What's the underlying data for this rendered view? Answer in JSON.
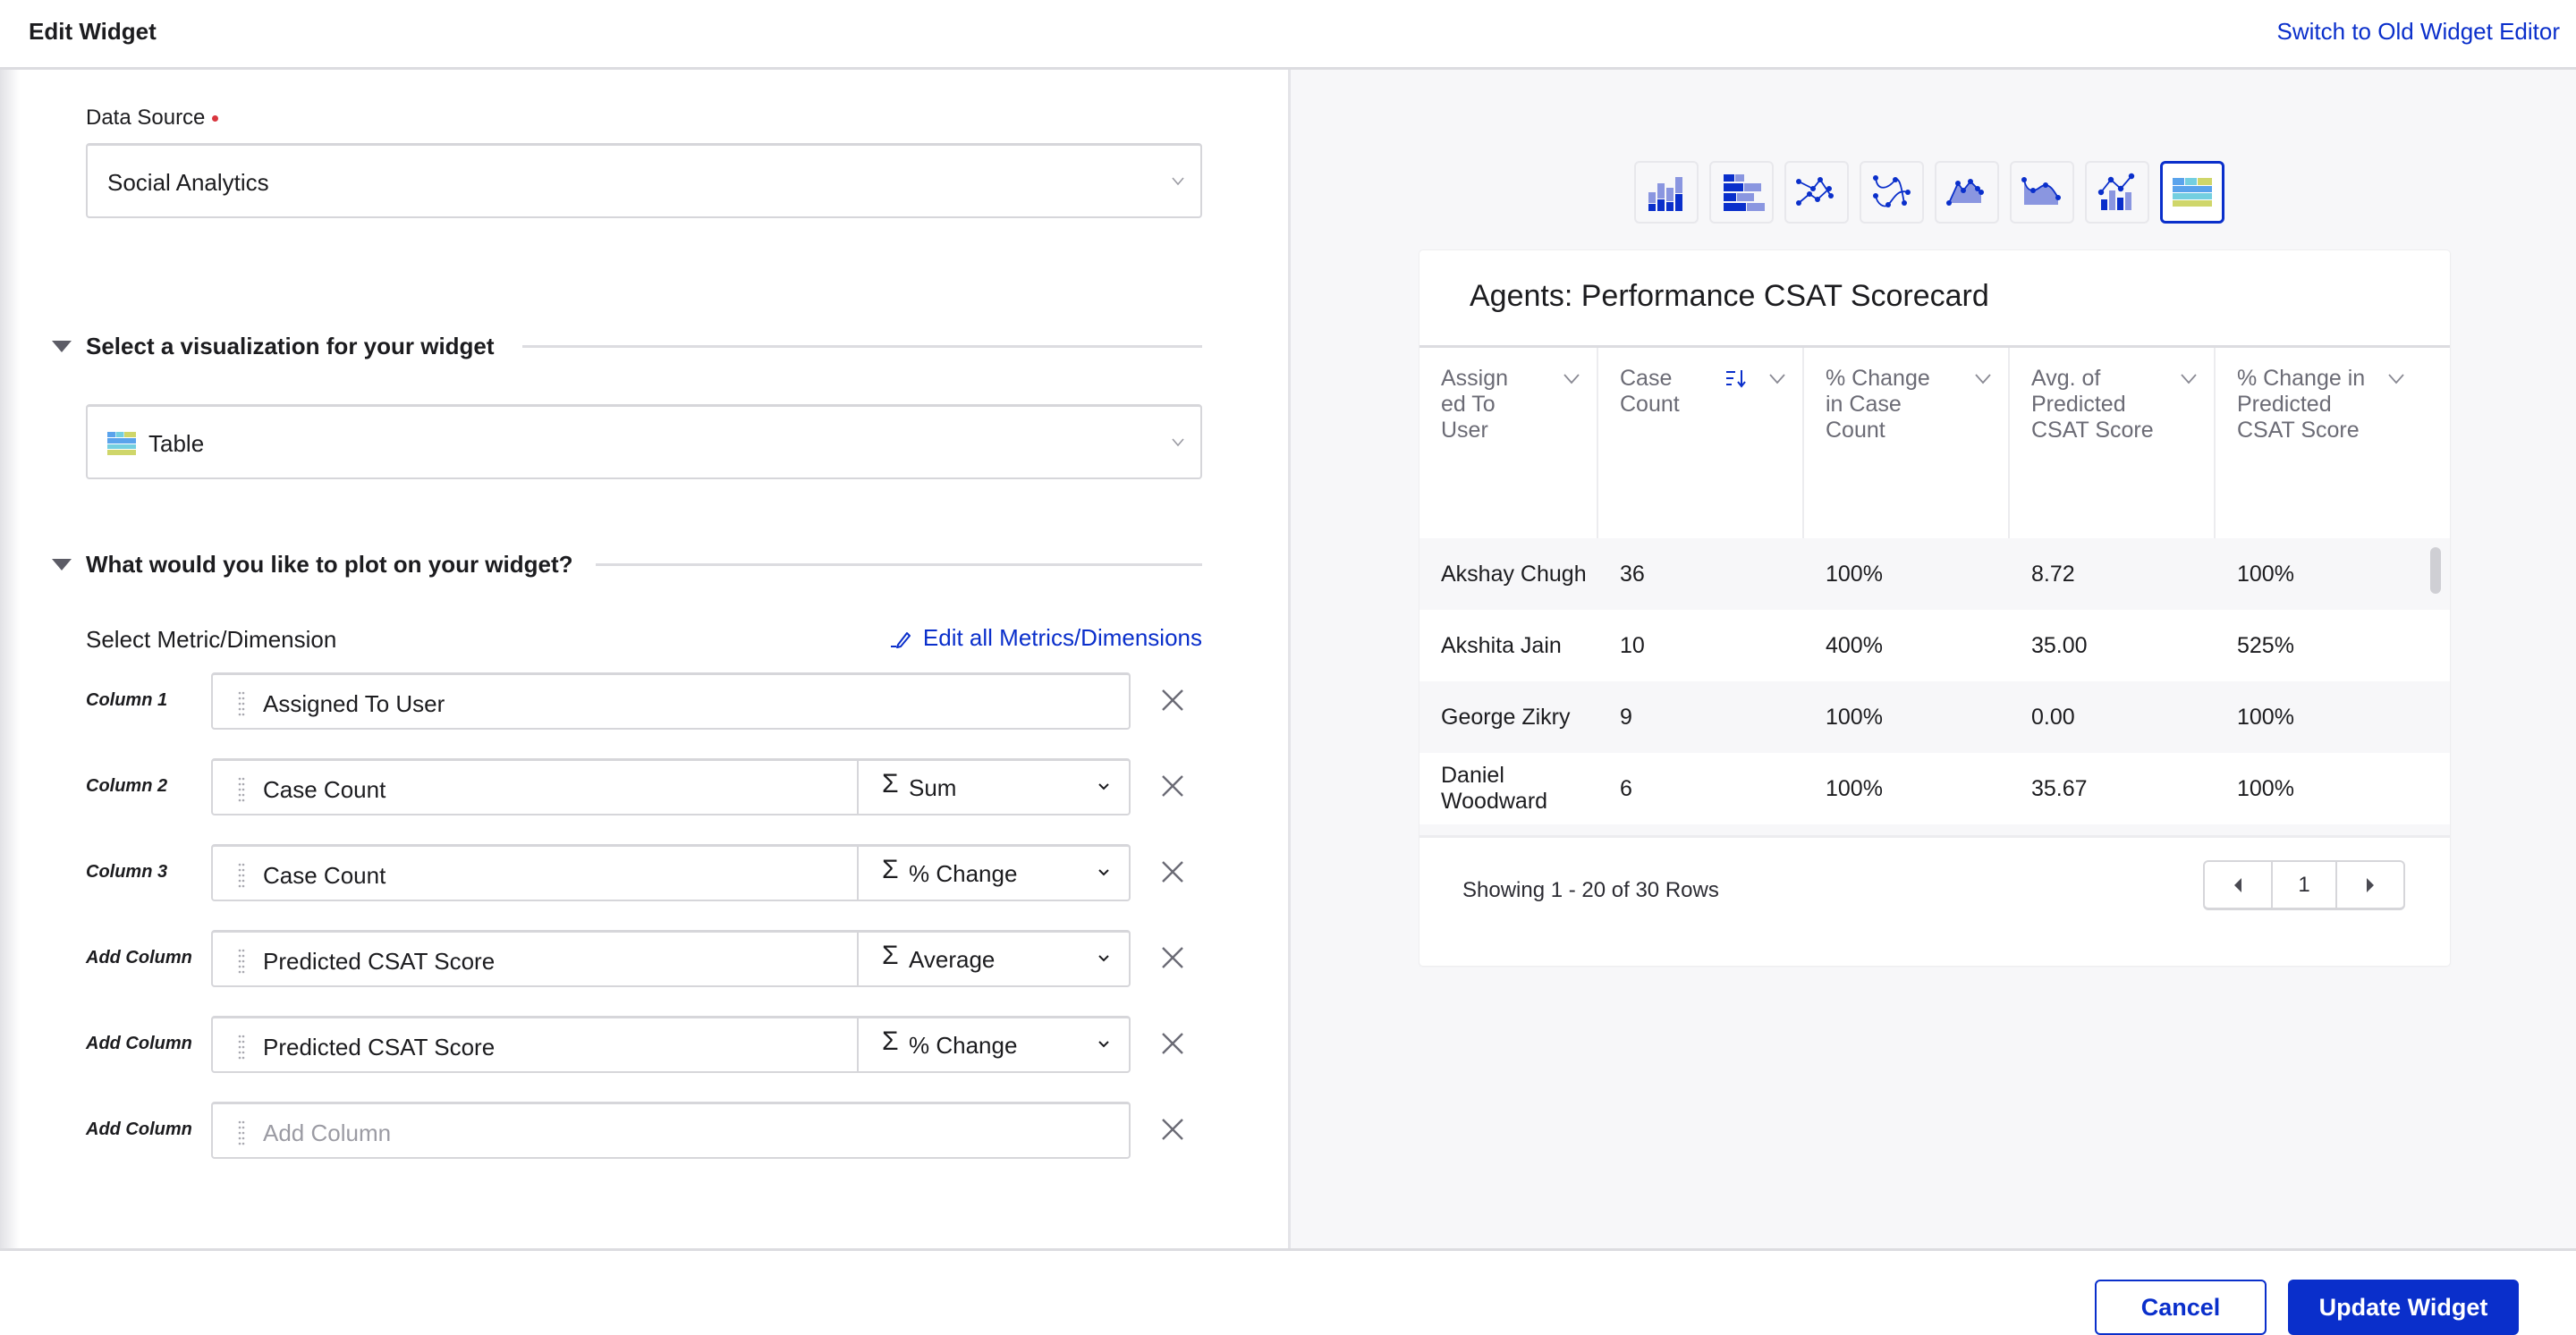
{
  "header": {
    "title": "Edit Widget",
    "switch_link": "Switch to Old Widget Editor"
  },
  "form": {
    "data_source": {
      "label": "Data Source",
      "required": true,
      "value": "Social Analytics",
      "icon": "chevron-down-icon"
    },
    "visualization_section": {
      "heading": "Select a visualization for your widget",
      "value": "Table",
      "icon": "table-viz-icon"
    },
    "plot_section": {
      "heading": "What would you like to plot on your widget?",
      "metric_label": "Select Metric/Dimension",
      "edit_all_link": "Edit all Metrics/Dimensions",
      "columns": [
        {
          "label": "Column 1",
          "field": "Assigned To User",
          "aggregation": null
        },
        {
          "label": "Column 2",
          "field": "Case Count",
          "aggregation": "Sum"
        },
        {
          "label": "Column 3",
          "field": "Case Count",
          "aggregation": "% Change"
        },
        {
          "label": "Add Column",
          "field": "Predicted CSAT Score",
          "aggregation": "Average"
        },
        {
          "label": "Add Column",
          "field": "Predicted CSAT Score",
          "aggregation": "% Change"
        },
        {
          "label": "Add Column",
          "field": "",
          "placeholder": "Add Column",
          "aggregation": null
        }
      ],
      "sigma_symbol": "Σ"
    }
  },
  "preview": {
    "viz_types": [
      {
        "name": "stacked-column",
        "active": false
      },
      {
        "name": "stacked-bar",
        "active": false
      },
      {
        "name": "line",
        "active": false
      },
      {
        "name": "spline",
        "active": false
      },
      {
        "name": "area",
        "active": false
      },
      {
        "name": "spline-area",
        "active": false
      },
      {
        "name": "combo",
        "active": false
      },
      {
        "name": "table",
        "active": true
      }
    ],
    "widget_title": "Agents: Performance CSAT Scorecard",
    "table": {
      "headers": [
        "Assign ed To User",
        "Case Count",
        "% Change in Case Count",
        "Avg. of Predicted CSAT Score",
        "% Change in Predicted CSAT Score"
      ],
      "sorted_column": 1,
      "rows": [
        [
          "Akshay Chugh",
          "36",
          "100%",
          "8.72",
          "100%"
        ],
        [
          "Akshita Jain",
          "10",
          "400%",
          "35.00",
          "525%"
        ],
        [
          "George Zikry",
          "9",
          "100%",
          "0.00",
          "100%"
        ],
        [
          "Daniel Woodward",
          "6",
          "100%",
          "35.67",
          "100%"
        ]
      ]
    },
    "pagination": {
      "showing_text": "Showing 1 - 20 of 30 Rows",
      "current_page": "1"
    }
  },
  "footer": {
    "cancel_label": "Cancel",
    "update_label": "Update Widget"
  },
  "colors": {
    "accent": "#0a2fcb",
    "required_dot": "#d9363e",
    "table_icon_blue": "#5aa3ec",
    "table_icon_teal": "#74cfe0",
    "table_icon_olive": "#cfd66a"
  }
}
